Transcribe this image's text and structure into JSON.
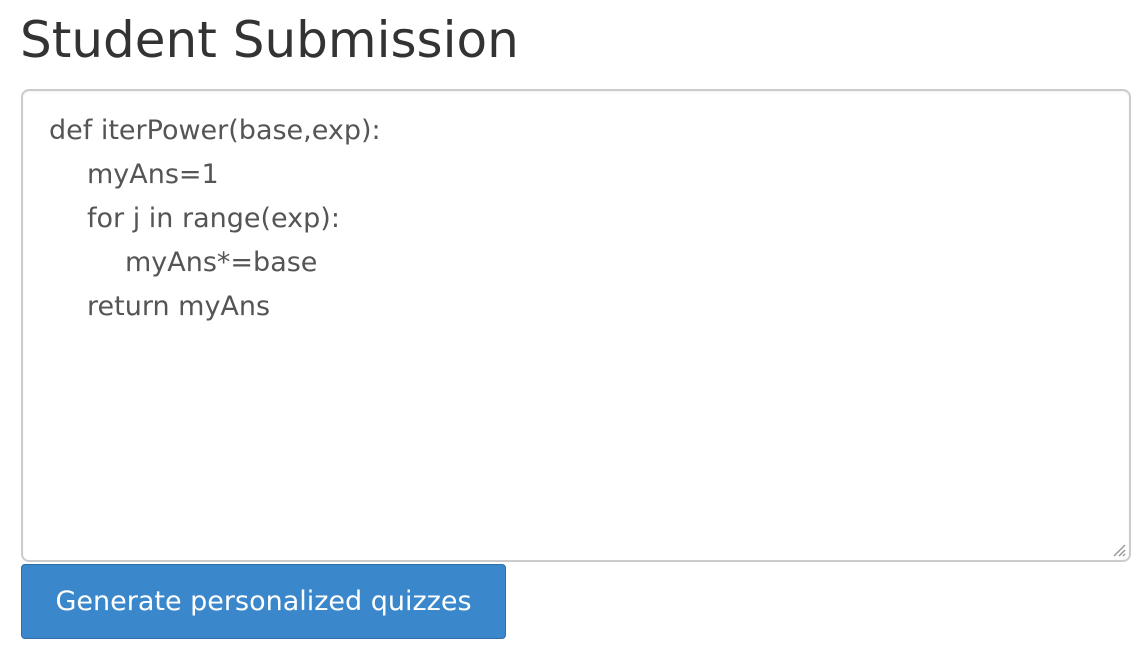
{
  "page": {
    "title": "Student Submission"
  },
  "submission": {
    "lines": [
      "def iterPower(base,exp):",
      "myAns=1",
      "for j in range(exp):",
      "myAns*=base",
      "return myAns"
    ]
  },
  "actions": {
    "generate_label": "Generate personalized quizzes"
  },
  "icons": {
    "resize": "resize-grip-icon"
  },
  "colors": {
    "button_bg": "#3a87cb",
    "button_text": "#ffffff",
    "title_text": "#333333",
    "code_text": "#555555",
    "textarea_border": "#cccccc"
  }
}
